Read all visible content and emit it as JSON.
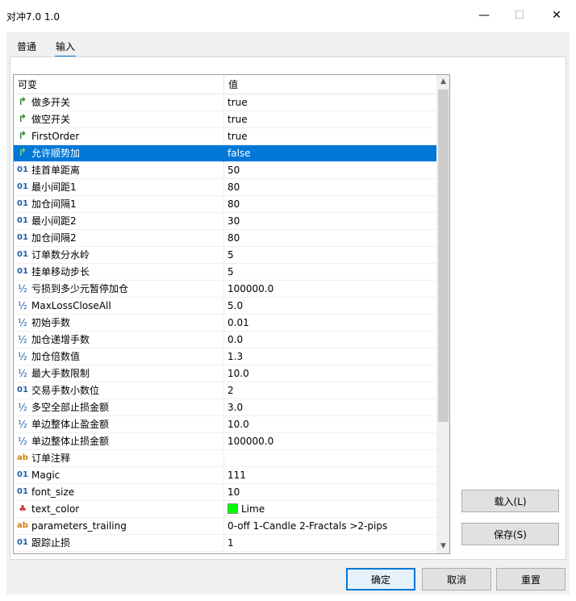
{
  "window": {
    "title": "对冲7.0 1.0"
  },
  "tabs": [
    {
      "label": "普通"
    },
    {
      "label": "输入"
    }
  ],
  "grid": {
    "headers": {
      "variable": "可变",
      "value": "值"
    },
    "rows": [
      {
        "icon": "bool",
        "name": "做多开关",
        "value": "true"
      },
      {
        "icon": "bool",
        "name": "做空开关",
        "value": "true"
      },
      {
        "icon": "bool",
        "name": "FirstOrder",
        "value": "true"
      },
      {
        "icon": "bool",
        "name": "允许顺势加",
        "value": "false",
        "selected": true
      },
      {
        "icon": "int",
        "name": "挂首单距离",
        "value": "50"
      },
      {
        "icon": "int",
        "name": "最小间距1",
        "value": "80"
      },
      {
        "icon": "int",
        "name": "加仓间隔1",
        "value": "80"
      },
      {
        "icon": "int",
        "name": "最小间距2",
        "value": "30"
      },
      {
        "icon": "int",
        "name": "加仓间隔2",
        "value": "80"
      },
      {
        "icon": "int",
        "name": "订单数分水岭",
        "value": "5"
      },
      {
        "icon": "int",
        "name": "挂单移动步长",
        "value": "5"
      },
      {
        "icon": "double",
        "name": "亏损到多少元暂停加仓",
        "value": "100000.0"
      },
      {
        "icon": "double",
        "name": "MaxLossCloseAll",
        "value": "5.0"
      },
      {
        "icon": "double",
        "name": "初始手数",
        "value": "0.01"
      },
      {
        "icon": "double",
        "name": "加仓递增手数",
        "value": "0.0"
      },
      {
        "icon": "double",
        "name": "加仓倍数值",
        "value": "1.3"
      },
      {
        "icon": "double",
        "name": "最大手数限制",
        "value": "10.0"
      },
      {
        "icon": "int",
        "name": "交易手数小数位",
        "value": "2"
      },
      {
        "icon": "double",
        "name": "多空全部止损金额",
        "value": "3.0"
      },
      {
        "icon": "double",
        "name": "单边整体止盈金额",
        "value": "10.0"
      },
      {
        "icon": "double",
        "name": "单边整体止损金额",
        "value": "100000.0"
      },
      {
        "icon": "string",
        "name": "订单注释",
        "value": ""
      },
      {
        "icon": "int",
        "name": "Magic",
        "value": "111"
      },
      {
        "icon": "int",
        "name": "font_size",
        "value": "10"
      },
      {
        "icon": "color",
        "name": "text_color",
        "value": "Lime",
        "swatch": "#00ff00"
      },
      {
        "icon": "string",
        "name": "parameters_trailing",
        "value": "0-off 1-Candle 2-Fractals >2-pips"
      },
      {
        "icon": "int",
        "name": "跟踪止损",
        "value": "1"
      }
    ]
  },
  "icons": {
    "bool": "↱",
    "int": "01",
    "double": "½",
    "string": "ab",
    "color": "♣"
  },
  "buttons": {
    "load": "载入(L)",
    "save": "保存(S)",
    "ok": "确定",
    "cancel": "取消",
    "reset": "重置"
  },
  "colors": {
    "accent": "#0078d7",
    "swatch_lime": "#00ff00"
  }
}
